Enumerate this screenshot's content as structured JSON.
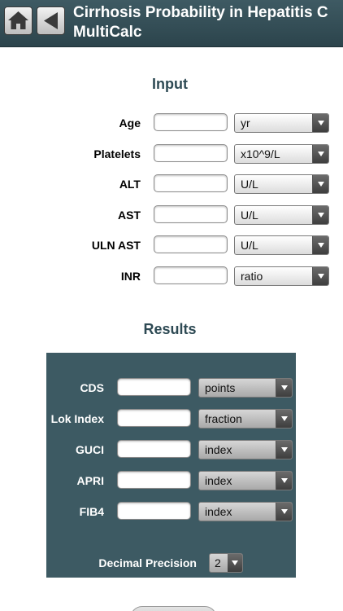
{
  "header": {
    "title": "Cirrhosis Probability in Hepatitis C MultiCalc",
    "home_icon": "home-icon",
    "back_icon": "back-arrow-icon"
  },
  "input": {
    "section_title": "Input",
    "rows": [
      {
        "label": "Age",
        "value": "",
        "unit": "yr"
      },
      {
        "label": "Platelets",
        "value": "",
        "unit": "x10^9/L"
      },
      {
        "label": "ALT",
        "value": "",
        "unit": "U/L"
      },
      {
        "label": "AST",
        "value": "",
        "unit": "U/L"
      },
      {
        "label": "ULN AST",
        "value": "",
        "unit": "U/L"
      },
      {
        "label": "INR",
        "value": "",
        "unit": "ratio"
      }
    ]
  },
  "results": {
    "section_title": "Results",
    "rows": [
      {
        "label": "CDS",
        "value": "",
        "unit": "points"
      },
      {
        "label": "Lok Index",
        "value": "",
        "unit": "fraction"
      },
      {
        "label": "GUCI",
        "value": "",
        "unit": "index"
      },
      {
        "label": "APRI",
        "value": "",
        "unit": "index"
      },
      {
        "label": "FIB4",
        "value": "",
        "unit": "index"
      }
    ],
    "precision_label": "Decimal Precision",
    "precision_value": "2"
  },
  "colors": {
    "header_bg": "#34505a",
    "panel_bg": "#3d5a63",
    "section_title": "#2e4a54"
  }
}
